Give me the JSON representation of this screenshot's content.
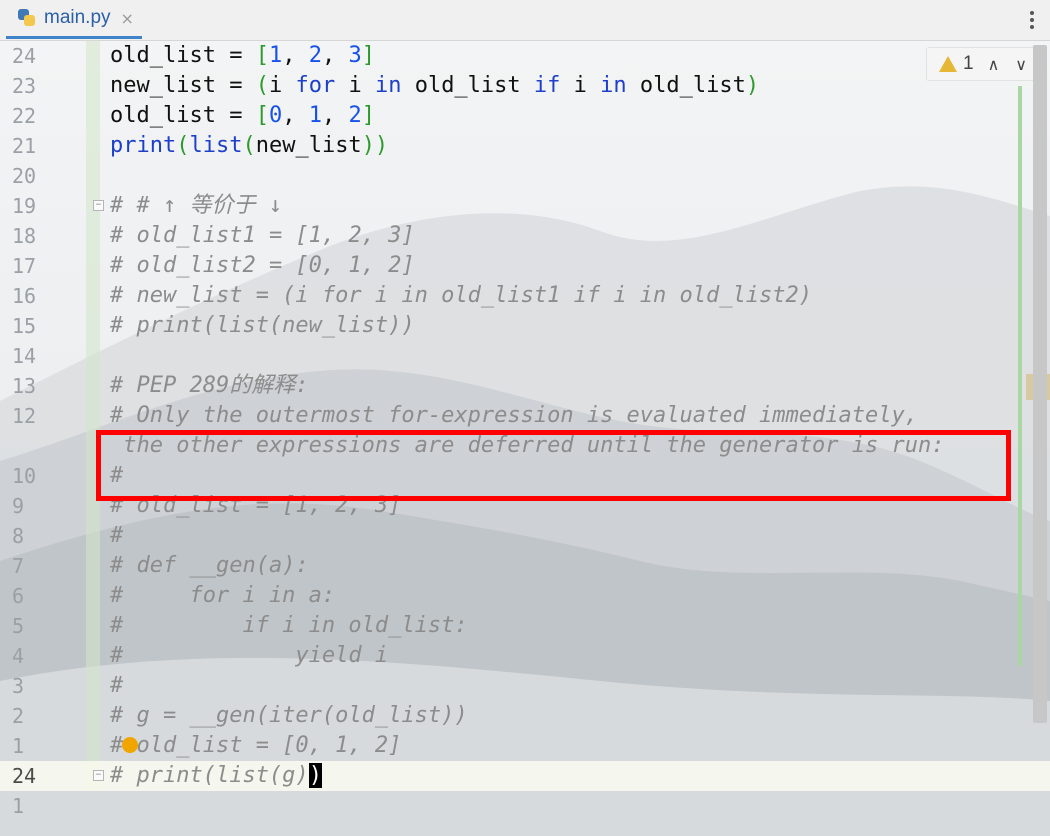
{
  "tab": {
    "file_name": "main.py",
    "close_glyph": "×"
  },
  "inspection": {
    "warning_count": "1",
    "up_glyph": "∧",
    "down_glyph": "∨"
  },
  "lines": [
    {
      "num": "24",
      "current": false,
      "parts": [
        [
          "old_list = ",
          ""
        ],
        [
          "[",
          "br"
        ],
        [
          "1",
          "num"
        ],
        [
          ", ",
          ""
        ],
        [
          "2",
          "num"
        ],
        [
          ", ",
          ""
        ],
        [
          "3",
          "num"
        ],
        [
          "]",
          "br"
        ]
      ]
    },
    {
      "num": "23",
      "current": false,
      "parts": [
        [
          "new_list = ",
          ""
        ],
        [
          "(",
          "br"
        ],
        [
          "i ",
          ""
        ],
        [
          "for",
          "kw"
        ],
        [
          " i ",
          ""
        ],
        [
          "in",
          "kw"
        ],
        [
          " old_list ",
          ""
        ],
        [
          "if",
          "kw"
        ],
        [
          " i ",
          ""
        ],
        [
          "in",
          "kw"
        ],
        [
          " old_list",
          ""
        ],
        [
          ")",
          "br"
        ]
      ]
    },
    {
      "num": "22",
      "current": false,
      "parts": [
        [
          "old_list = ",
          ""
        ],
        [
          "[",
          "br"
        ],
        [
          "0",
          "num"
        ],
        [
          ", ",
          ""
        ],
        [
          "1",
          "num"
        ],
        [
          ", ",
          ""
        ],
        [
          "2",
          "num"
        ],
        [
          "]",
          "br"
        ]
      ]
    },
    {
      "num": "21",
      "current": false,
      "parts": [
        [
          "print",
          "kw"
        ],
        [
          "(",
          "br"
        ],
        [
          "list",
          "kw"
        ],
        [
          "(",
          "br"
        ],
        [
          "new_list",
          ""
        ],
        [
          "))",
          "br"
        ]
      ]
    },
    {
      "num": "20",
      "current": false,
      "parts": []
    },
    {
      "num": "19",
      "current": false,
      "parts": [
        [
          "# # ↑ 等价于 ↓",
          "cmt"
        ]
      ]
    },
    {
      "num": "18",
      "current": false,
      "parts": [
        [
          "# old_list1 = [1, 2, 3]",
          "cmt"
        ]
      ]
    },
    {
      "num": "17",
      "current": false,
      "parts": [
        [
          "# old_list2 = [0, 1, 2]",
          "cmt"
        ]
      ]
    },
    {
      "num": "16",
      "current": false,
      "parts": [
        [
          "# new_list = (i for i in old_list1 if i in old_list2)",
          "cmt"
        ]
      ]
    },
    {
      "num": "15",
      "current": false,
      "parts": [
        [
          "# print(list(new_list))",
          "cmt"
        ]
      ]
    },
    {
      "num": "14",
      "current": false,
      "parts": []
    },
    {
      "num": "13",
      "current": false,
      "parts": [
        [
          "# PEP 289的解释:",
          "cmt"
        ]
      ]
    },
    {
      "num": "12",
      "current": false,
      "parts": [
        [
          "# Only the outermost for-expression is evaluated immediately,",
          "cmt"
        ]
      ]
    },
    {
      "num": "",
      "current": false,
      "parts": [
        [
          " the other expressions are deferred until the generator is run:",
          "cmt"
        ]
      ]
    },
    {
      "num": "10",
      "current": false,
      "parts": [
        [
          "#",
          "cmt"
        ]
      ]
    },
    {
      "num": "9",
      "current": false,
      "parts": [
        [
          "# old_list = [1, 2, 3]",
          "cmt"
        ]
      ]
    },
    {
      "num": "8",
      "current": false,
      "parts": [
        [
          "#",
          "cmt"
        ]
      ]
    },
    {
      "num": "7",
      "current": false,
      "parts": [
        [
          "# def __gen(a):",
          "cmt"
        ]
      ]
    },
    {
      "num": "6",
      "current": false,
      "parts": [
        [
          "#     for i in a:",
          "cmt"
        ]
      ]
    },
    {
      "num": "5",
      "current": false,
      "parts": [
        [
          "#         if i in old_list:",
          "cmt"
        ]
      ]
    },
    {
      "num": "4",
      "current": false,
      "parts": [
        [
          "#             yield i",
          "cmt"
        ]
      ]
    },
    {
      "num": "3",
      "current": false,
      "parts": [
        [
          "#",
          "cmt"
        ]
      ]
    },
    {
      "num": "2",
      "current": false,
      "parts": [
        [
          "# g = __gen(iter(old_list))",
          "cmt"
        ]
      ]
    },
    {
      "num": "1",
      "current": false,
      "parts": [
        [
          "# old_list = [0, 1, 2]",
          "cmt"
        ]
      ]
    },
    {
      "num": "24",
      "current": true,
      "parts": [
        [
          "# print(list(g)",
          "cmt"
        ],
        [
          ")",
          "cursor"
        ]
      ]
    },
    {
      "num": "1",
      "current": false,
      "parts": []
    }
  ],
  "colors": {
    "keyword": "#1d3fc9",
    "number": "#1750eb",
    "bracket": "#2d9a2d",
    "comment": "#8c8c8c",
    "highlight_box": "#ff0000"
  }
}
